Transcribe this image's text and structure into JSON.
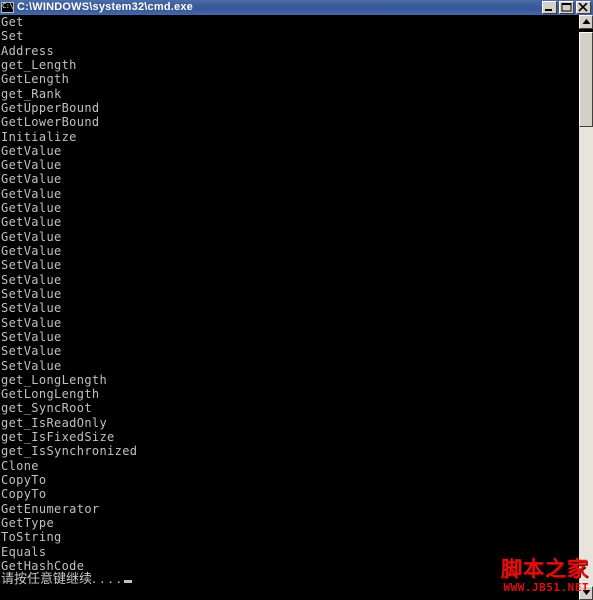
{
  "window": {
    "title": "C:\\WINDOWS\\system32\\cmd.exe",
    "icon": "console-icon",
    "minimize_label": "Minimize",
    "maximize_label": "Maximize",
    "close_label": "Close"
  },
  "console": {
    "background_color": "#000000",
    "text_color": "#c0c0c0",
    "lines": [
      "Get",
      "Set",
      "Address",
      "get_Length",
      "GetLength",
      "get_Rank",
      "GetUpperBound",
      "GetLowerBound",
      "Initialize",
      "GetValue",
      "GetValue",
      "GetValue",
      "GetValue",
      "GetValue",
      "GetValue",
      "GetValue",
      "GetValue",
      "SetValue",
      "SetValue",
      "SetValue",
      "SetValue",
      "SetValue",
      "SetValue",
      "SetValue",
      "SetValue",
      "get_LongLength",
      "GetLongLength",
      "get_SyncRoot",
      "get_IsReadOnly",
      "get_IsFixedSize",
      "get_IsSynchronized",
      "Clone",
      "CopyTo",
      "CopyTo",
      "GetEnumerator",
      "GetType",
      "ToString",
      "Equals",
      "GetHashCode"
    ],
    "prompt_line": "请按任意键继续. . . ."
  },
  "scrollbar": {
    "up_arrow": "scroll-up-arrow-icon",
    "down_arrow": "scroll-down-arrow-icon",
    "thumb": "scroll-thumb"
  },
  "watermark": {
    "chinese": "脚本之家",
    "url": "WWW.JB51.NET",
    "color": "#e01010"
  }
}
